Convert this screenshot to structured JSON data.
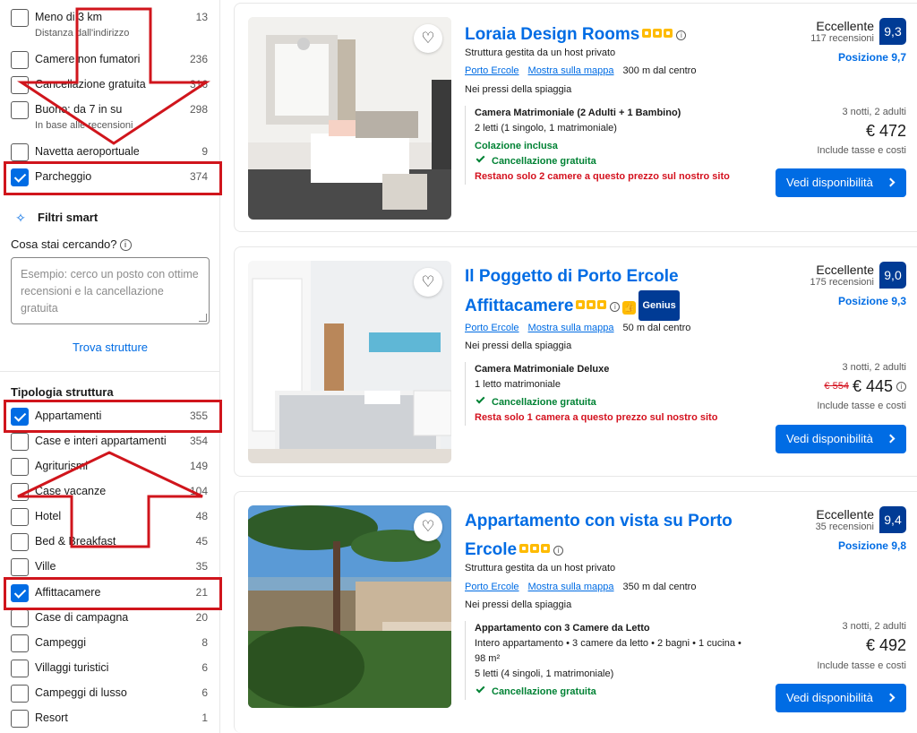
{
  "filters_top": [
    {
      "label": "Meno di 3 km",
      "sub": "Distanza dall'indirizzo",
      "count": "13",
      "checked": false
    },
    {
      "label": "Camere non fumatori",
      "sub": "",
      "count": "236",
      "checked": false
    },
    {
      "label": "Cancellazione gratuita",
      "sub": "",
      "count": "316",
      "checked": false
    },
    {
      "label": "Buono: da 7 in su",
      "sub": "In base alle recensioni",
      "count": "298",
      "checked": false
    },
    {
      "label": "Navetta aeroportuale",
      "sub": "",
      "count": "9",
      "checked": false
    },
    {
      "label": "Parcheggio",
      "sub": "",
      "count": "374",
      "checked": true
    }
  ],
  "smart": {
    "title": "Filtri smart",
    "question": "Cosa stai cercando?",
    "placeholder": "Esempio: cerco un posto con ottime recensioni e la cancellazione gratuita",
    "find_link": "Trova strutture"
  },
  "structure_type": {
    "title": "Tipologia struttura",
    "items": [
      {
        "label": "Appartamenti",
        "count": "355",
        "checked": true
      },
      {
        "label": "Case e interi appartamenti",
        "count": "354",
        "checked": false
      },
      {
        "label": "Agriturismi",
        "count": "149",
        "checked": false
      },
      {
        "label": "Case vacanze",
        "count": "104",
        "checked": false
      },
      {
        "label": "Hotel",
        "count": "48",
        "checked": false
      },
      {
        "label": "Bed & Breakfast",
        "count": "45",
        "checked": false
      },
      {
        "label": "Ville",
        "count": "35",
        "checked": false
      },
      {
        "label": "Affittacamere",
        "count": "21",
        "checked": true
      },
      {
        "label": "Case di campagna",
        "count": "20",
        "checked": false
      },
      {
        "label": "Campeggi",
        "count": "8",
        "checked": false
      },
      {
        "label": "Villaggi turistici",
        "count": "6",
        "checked": false
      },
      {
        "label": "Campeggi di lusso",
        "count": "6",
        "checked": false
      },
      {
        "label": "Resort",
        "count": "1",
        "checked": false
      }
    ]
  },
  "cards": [
    {
      "name": "Loraia Design Rooms",
      "stars": 3,
      "genius": "",
      "host": "Struttura gestita da un host privato",
      "town": "Porto Ercole",
      "map": "Mostra sulla mappa",
      "distance": "300 m dal centro",
      "beach": "Nei pressi della spiaggia",
      "room": "Camera Matrimoniale (2 Adulti + 1 Bambino)",
      "beds": "2 letti (1 singolo, 1 matrimoniale)",
      "extra": "",
      "beds2": "",
      "breakfast": "Colazione inclusa",
      "cancel": "Cancellazione gratuita",
      "scarcity": "Restano solo 2 camere a questo prezzo sul nostro sito",
      "rating_word": "Eccellente",
      "reviews": "117 recensioni",
      "score": "9,3",
      "position": "Posizione 9,7",
      "nights": "3 notti, 2 adulti",
      "old_price": "",
      "price": "€ 472",
      "taxes": "Include tasse e costi",
      "button": "Vedi disponibilità"
    },
    {
      "name": "Il Poggetto di Porto Ercole Affittacamere",
      "stars": 3,
      "genius": "Genius",
      "host": "",
      "town": "Porto Ercole",
      "map": "Mostra sulla mappa",
      "distance": "50 m dal centro",
      "beach": "Nei pressi della spiaggia",
      "room": "Camera Matrimoniale Deluxe",
      "beds": "1 letto matrimoniale",
      "extra": "",
      "beds2": "",
      "breakfast": "",
      "cancel": "Cancellazione gratuita",
      "scarcity": "Resta solo 1 camera a questo prezzo sul nostro sito",
      "rating_word": "Eccellente",
      "reviews": "175 recensioni",
      "score": "9,0",
      "position": "Posizione 9,3",
      "nights": "3 notti, 2 adulti",
      "old_price": "€ 554",
      "price": "€ 445",
      "taxes": "Include tasse e costi",
      "button": "Vedi disponibilità"
    },
    {
      "name": "Appartamento con vista su Porto Ercole",
      "stars": 3,
      "genius": "",
      "host": "Struttura gestita da un host privato",
      "town": "Porto Ercole",
      "map": "Mostra sulla mappa",
      "distance": "350 m dal centro",
      "beach": "Nei pressi della spiaggia",
      "room": "Appartamento con 3 Camere da Letto",
      "beds": "Intero appartamento • 3 camere da letto • 2 bagni • 1 cucina •",
      "extra": "98 m²",
      "beds2": "5 letti (4 singoli, 1 matrimoniale)",
      "breakfast": "",
      "cancel": "Cancellazione gratuita",
      "scarcity": "",
      "rating_word": "Eccellente",
      "reviews": "35 recensioni",
      "score": "9,4",
      "position": "Posizione 9,8",
      "nights": "3 notti, 2 adulti",
      "old_price": "",
      "price": "€ 492",
      "taxes": "Include tasse e costi",
      "button": "Vedi disponibilità"
    }
  ]
}
